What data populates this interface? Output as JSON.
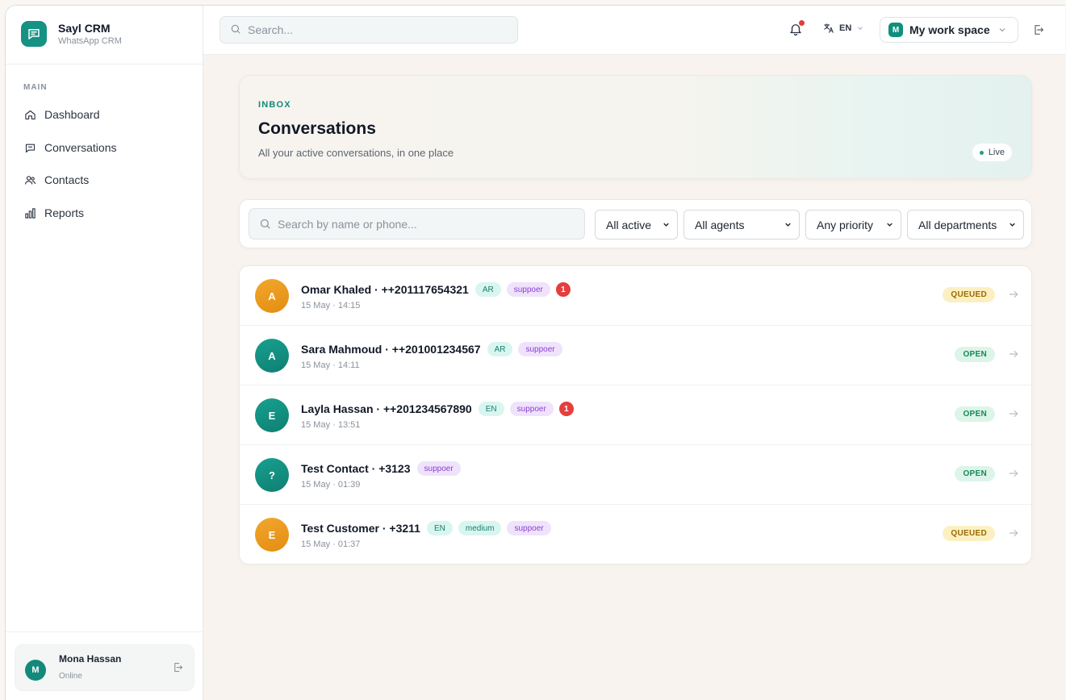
{
  "brand": {
    "title": "Sayl CRM",
    "subtitle": "WhatsApp CRM"
  },
  "sidebar": {
    "section": "MAIN",
    "items": [
      {
        "label": "Dashboard",
        "icon": "home-icon"
      },
      {
        "label": "Conversations",
        "icon": "chat-icon"
      },
      {
        "label": "Contacts",
        "icon": "users-icon"
      },
      {
        "label": "Reports",
        "icon": "bar-chart-icon"
      }
    ],
    "user": {
      "initial": "M",
      "name": "Mona Hassan",
      "status": "Online"
    }
  },
  "topbar": {
    "search_placeholder": "Search...",
    "language": "EN",
    "workspace": {
      "initial": "M",
      "label": "My work space"
    }
  },
  "hero": {
    "kicker": "INBOX",
    "title": "Conversations",
    "subtitle": "All your active conversations, in one place",
    "live": "Live"
  },
  "filters": {
    "search_placeholder": "Search by name or phone...",
    "status": "All active",
    "agents": "All agents",
    "priority": "Any priority",
    "departments": "All departments"
  },
  "conversations": [
    {
      "initial": "A",
      "color": "#e9961c",
      "name": "Omar Khaled · ++201117654321",
      "lang": "AR",
      "priority": "",
      "dept": "suppoer",
      "unread": "1",
      "time": "15 May · 14:15",
      "status": "QUEUED"
    },
    {
      "initial": "A",
      "color": "#12897a",
      "name": "Sara Mahmoud · ++201001234567",
      "lang": "AR",
      "priority": "",
      "dept": "suppoer",
      "unread": "",
      "time": "15 May · 14:11",
      "status": "OPEN"
    },
    {
      "initial": "E",
      "color": "#12897a",
      "name": "Layla Hassan · ++201234567890",
      "lang": "EN",
      "priority": "",
      "dept": "suppoer",
      "unread": "1",
      "time": "15 May · 13:51",
      "status": "OPEN"
    },
    {
      "initial": "?",
      "color": "#12897a",
      "name": "Test Contact · +3123",
      "lang": "",
      "priority": "",
      "dept": "suppoer",
      "unread": "",
      "time": "15 May · 01:39",
      "status": "OPEN"
    },
    {
      "initial": "E",
      "color": "#e9961c",
      "name": "Test Customer · +3211",
      "lang": "EN",
      "priority": "medium",
      "dept": "suppoer",
      "unread": "",
      "time": "15 May · 01:37",
      "status": "QUEUED"
    }
  ],
  "colors": {
    "accent": "#12897a",
    "queued": "#fcf0c2",
    "open": "#dcf5e8",
    "unread": "#e53e3e"
  }
}
